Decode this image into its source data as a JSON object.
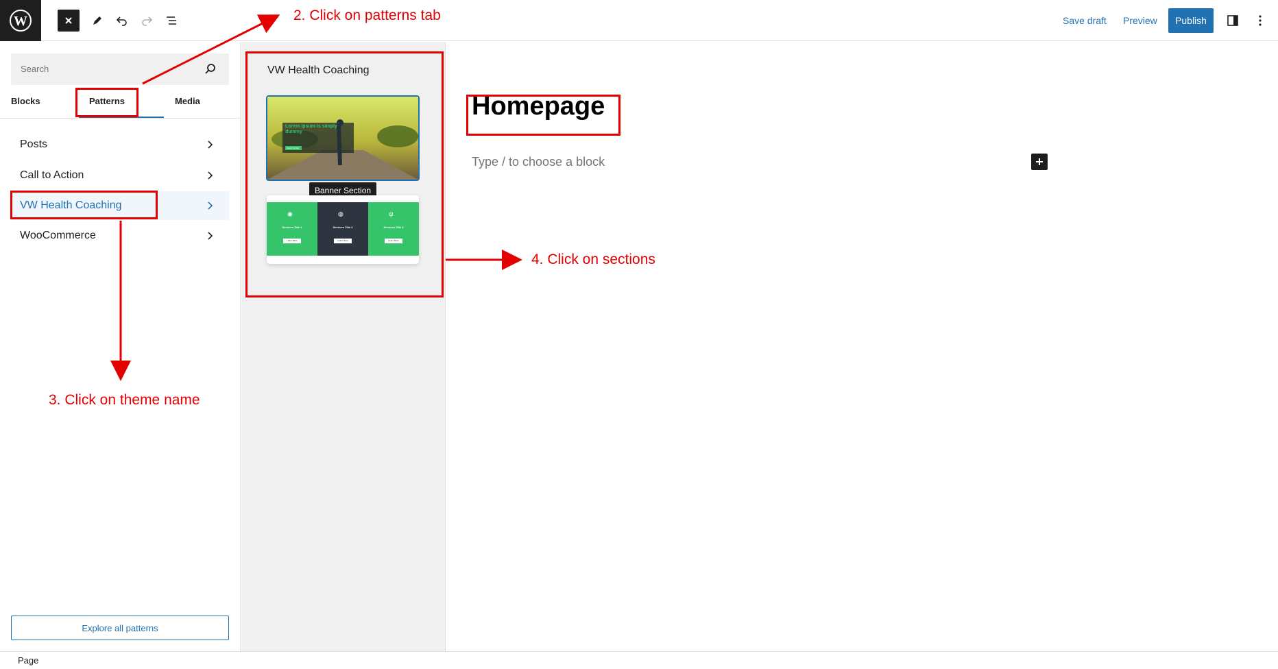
{
  "toolbar": {
    "close_icon": "close-icon",
    "save_draft": "Save draft",
    "preview": "Preview",
    "publish": "Publish"
  },
  "inserter": {
    "search_placeholder": "Search",
    "tabs": [
      {
        "label": "Blocks"
      },
      {
        "label": "Patterns",
        "selected": true
      },
      {
        "label": "Media"
      }
    ],
    "categories": [
      {
        "label": "Posts"
      },
      {
        "label": "Call to Action"
      },
      {
        "label": "VW Health Coaching",
        "active": true
      },
      {
        "label": "WooCommerce"
      }
    ],
    "explore_button": "Explore all patterns"
  },
  "patterns_panel": {
    "title": "VW Health Coaching",
    "tooltip": "Banner Section",
    "pattern1": {
      "heading": "Lorem ipsum is simply dummy",
      "button": "READ MORE"
    },
    "pattern2": {
      "columns": [
        {
          "title": "Services Title 1",
          "button": "Learn More"
        },
        {
          "title": "Services Title 2",
          "button": "Learn More"
        },
        {
          "title": "Services Title 3",
          "button": "Learn More"
        }
      ]
    }
  },
  "canvas": {
    "title": "Homepage",
    "placeholder": "Type / to choose a block"
  },
  "footer": {
    "label": "Page"
  },
  "annotations": {
    "step2": "2. Click on patterns tab",
    "step3": "3. Click on theme name",
    "step4": "4. Click on sections"
  },
  "colors": {
    "accent": "#2271b1",
    "annotation": "#e20000",
    "pattern_green": "#35c46a",
    "pattern_dark": "#2f3540"
  }
}
